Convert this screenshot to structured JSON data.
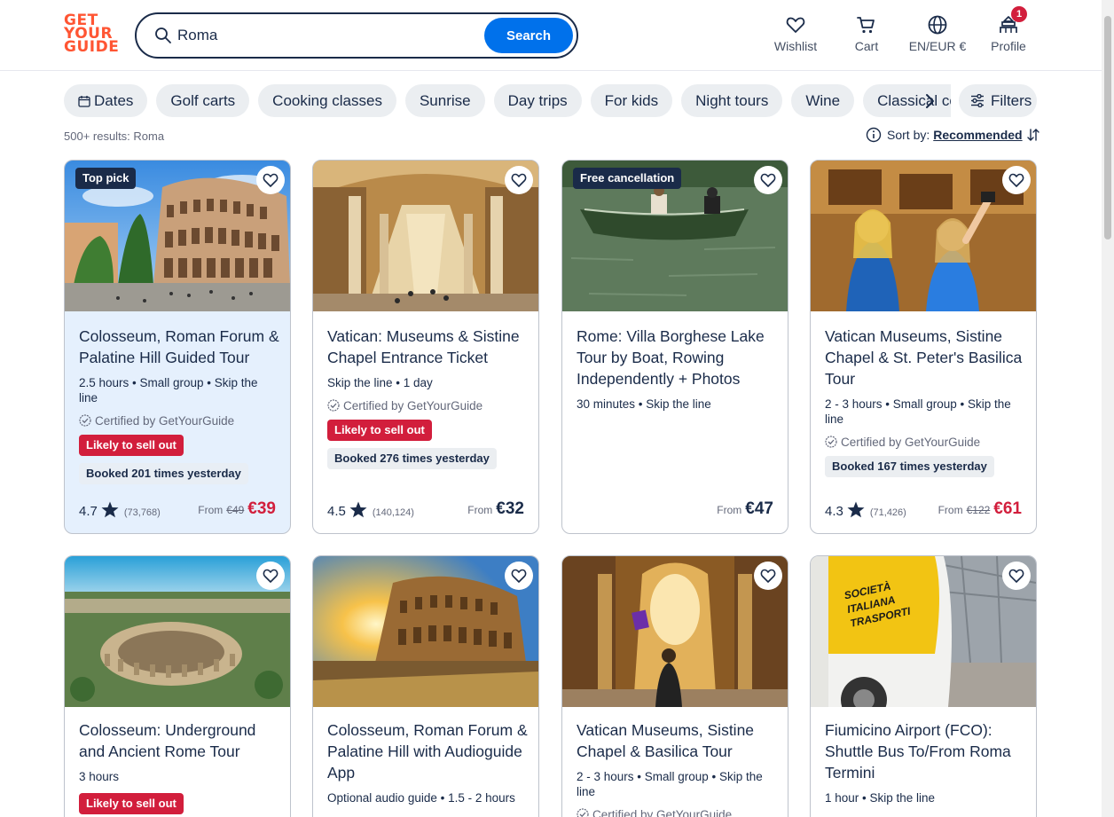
{
  "logo": {
    "line1": "GET",
    "line2": "YOUR",
    "line3": "GUIDE"
  },
  "search": {
    "value": "Roma",
    "button": "Search"
  },
  "nav": {
    "wishlist": "Wishlist",
    "cart": "Cart",
    "language": "EN/EUR €",
    "profile": "Profile",
    "profile_badge": "1"
  },
  "chips": [
    "Dates",
    "Golf carts",
    "Cooking classes",
    "Sunrise",
    "Day trips",
    "For kids",
    "Night tours",
    "Wine",
    "Classical concerts"
  ],
  "filters": "Filters",
  "results": "500+ results: Roma",
  "sort": {
    "label": "Sort by:",
    "value": "Recommended"
  },
  "colors": {
    "brand": "#ff5533",
    "accent": "#0071eb",
    "sale": "#d21e3c",
    "navy": "#1a2b49"
  },
  "cards": [
    {
      "tag": "Top pick",
      "title": "Colosseum, Roman Forum & Palatine Hill Guided Tour",
      "meta": "2.5 hours • Small group • Skip the line",
      "certified": "Certified by GetYourGuide",
      "sellout": "Likely to sell out",
      "booked": "Booked 201 times yesterday",
      "rating": "4.7",
      "reviews": "(73,768)",
      "from": "From",
      "old_price": "€49",
      "price": "€39"
    },
    {
      "title": "Vatican: Museums & Sistine Chapel Entrance Ticket",
      "meta": "Skip the line • 1 day",
      "certified": "Certified by GetYourGuide",
      "sellout": "Likely to sell out",
      "booked": "Booked 276 times yesterday",
      "rating": "4.5",
      "reviews": "(140,124)",
      "from": "From",
      "price": "€32"
    },
    {
      "tag": "Free cancellation",
      "title": "Rome: Villa Borghese Lake Tour by Boat, Rowing Independently + Photos",
      "meta": "30 minutes • Skip the line",
      "from": "From",
      "price": "€47"
    },
    {
      "title": "Vatican Museums, Sistine Chapel & St. Peter's Basilica Tour",
      "meta": "2 - 3 hours • Small group • Skip the line",
      "certified": "Certified by GetYourGuide",
      "booked": "Booked 167 times yesterday",
      "rating": "4.3",
      "reviews": "(71,426)",
      "from": "From",
      "old_price": "€122",
      "price": "€61"
    },
    {
      "title": "Colosseum: Underground and Ancient Rome Tour",
      "meta": "3 hours",
      "sellout": "Likely to sell out"
    },
    {
      "title": "Colosseum, Roman Forum & Palatine Hill with Audioguide App",
      "meta": "Optional audio guide • 1.5 - 2 hours"
    },
    {
      "title": "Vatican Museums, Sistine Chapel & Basilica Tour",
      "meta": "2 - 3 hours • Small group • Skip the line",
      "certified": "Certified by GetYourGuide"
    },
    {
      "title": "Fiumicino Airport (FCO): Shuttle Bus To/From Roma Termini",
      "meta": "1 hour • Skip the line",
      "bus_text1": "SOCIETÀ",
      "bus_text2": "ITALIANA",
      "bus_text3": "TRASPORTI"
    }
  ]
}
